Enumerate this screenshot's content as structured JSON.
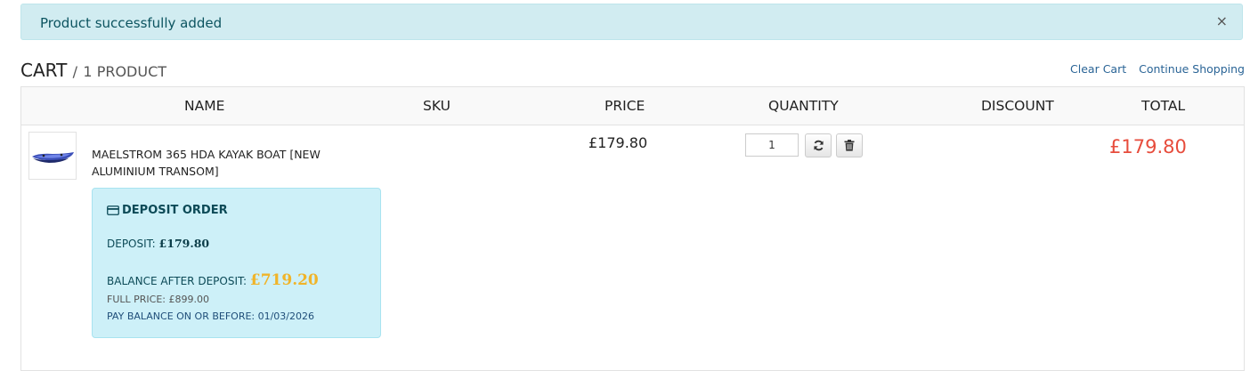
{
  "alert": {
    "message": "Product successfully added",
    "close": "×"
  },
  "cart": {
    "title": "CART",
    "separator": "/",
    "count": "1 PRODUCT"
  },
  "links": {
    "clear": "Clear Cart",
    "continue": "Continue Shopping"
  },
  "columns": {
    "name": "NAME",
    "sku": "SKU",
    "price": "PRICE",
    "quantity": "QUANTITY",
    "discount": "DISCOUNT",
    "total": "TOTAL"
  },
  "item": {
    "name": "MAELSTROM 365 HDA KAYAK BOAT [NEW ALUMINIUM TRANSOM]",
    "sku": "",
    "price": "£179.80",
    "quantity": "1",
    "discount": "",
    "total": "£179.80",
    "deposit": {
      "heading": "DEPOSIT ORDER",
      "deposit_label": "DEPOSIT:",
      "deposit_value": "£179.80",
      "balance_label": "BALANCE AFTER DEPOSIT:",
      "balance_value": "£719.20",
      "full_price": "FULL PRICE: £899.00",
      "pay_by": "PAY BALANCE ON OR BEFORE: 01/03/2026"
    }
  },
  "icons": {
    "thumb": "kayak-image",
    "card": "credit-card-icon",
    "refresh": "refresh-icon",
    "delete": "trash-icon",
    "close": "close-icon"
  },
  "colors": {
    "alert_bg": "#d1ecf1",
    "total": "#e74c3c",
    "balance": "#f0b429",
    "deposit_bg": "#cdf0f8",
    "link": "#2a6496"
  }
}
